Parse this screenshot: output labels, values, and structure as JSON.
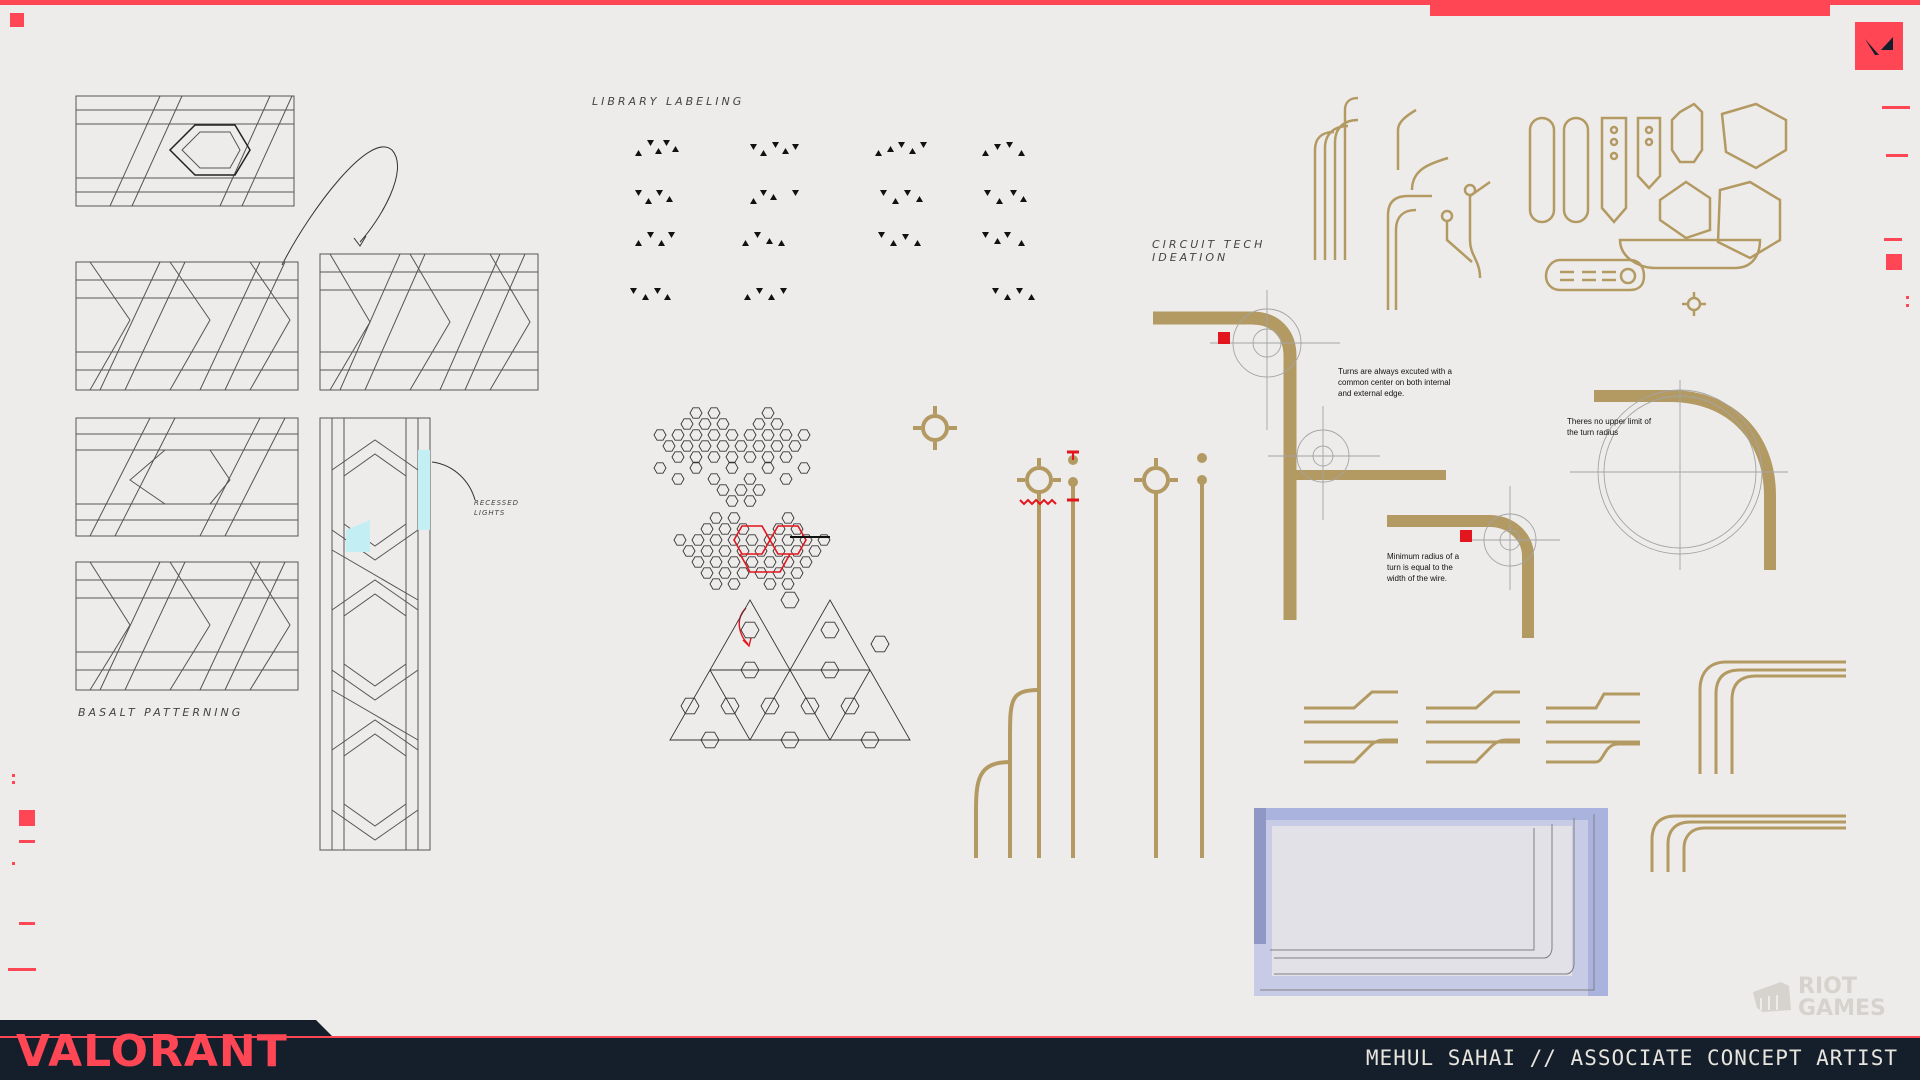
{
  "labels": {
    "library_labeling": "LIBRARY LABELING",
    "circuit_tech_ideation": "CIRCUIT TECH IDEATION",
    "basalt_patterning": "BASALT PATTERNING",
    "recessed_lights": "RECESSED LIGHTS"
  },
  "notes": {
    "turns_common_center": "Turns are always excuted with a common center on both internal and external edge.",
    "no_upper_limit": "Theres no upper limit of the turn radius",
    "minimum_radius": "Minimum radius of a turn is equal to the width of the wire."
  },
  "branding": {
    "game_logo": "VALORANT",
    "publisher_logo_line1": "RIOT",
    "publisher_logo_line2": "GAMES",
    "credit": "MEHUL SAHAI // ASSOCIATE CONCEPT ARTIST"
  },
  "colors": {
    "accent_red": "#ff4655",
    "gold": "#b39a62",
    "footer_navy": "#141f2b",
    "paper": "#eeeceb",
    "glow_cyan": "#c3eef3",
    "glass_blue": "#aab3dd"
  },
  "icons": {
    "badge": "valorant-v-icon",
    "riot": "riot-fist-icon"
  }
}
